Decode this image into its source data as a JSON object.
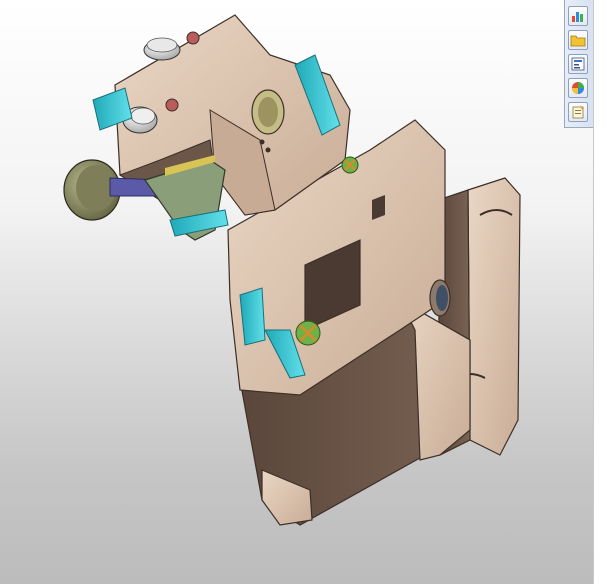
{
  "window": {
    "background_top": "#ffffff",
    "background_bottom": "#bcbcbc"
  },
  "task_pane": {
    "tabs": [
      {
        "icon": "solidworks-resources-icon"
      },
      {
        "icon": "design-library-folder-icon"
      },
      {
        "icon": "file-explorer-icon"
      },
      {
        "icon": "appearances-scenes-icon"
      },
      {
        "icon": "custom-properties-icon"
      }
    ]
  },
  "model": {
    "body_color": "#d9c2ae",
    "dark_face_color": "#6b5648",
    "cyan_part_color": "#39c9d6",
    "knob_color": "#8a8a62",
    "bushing_color": "#b9b07a"
  }
}
